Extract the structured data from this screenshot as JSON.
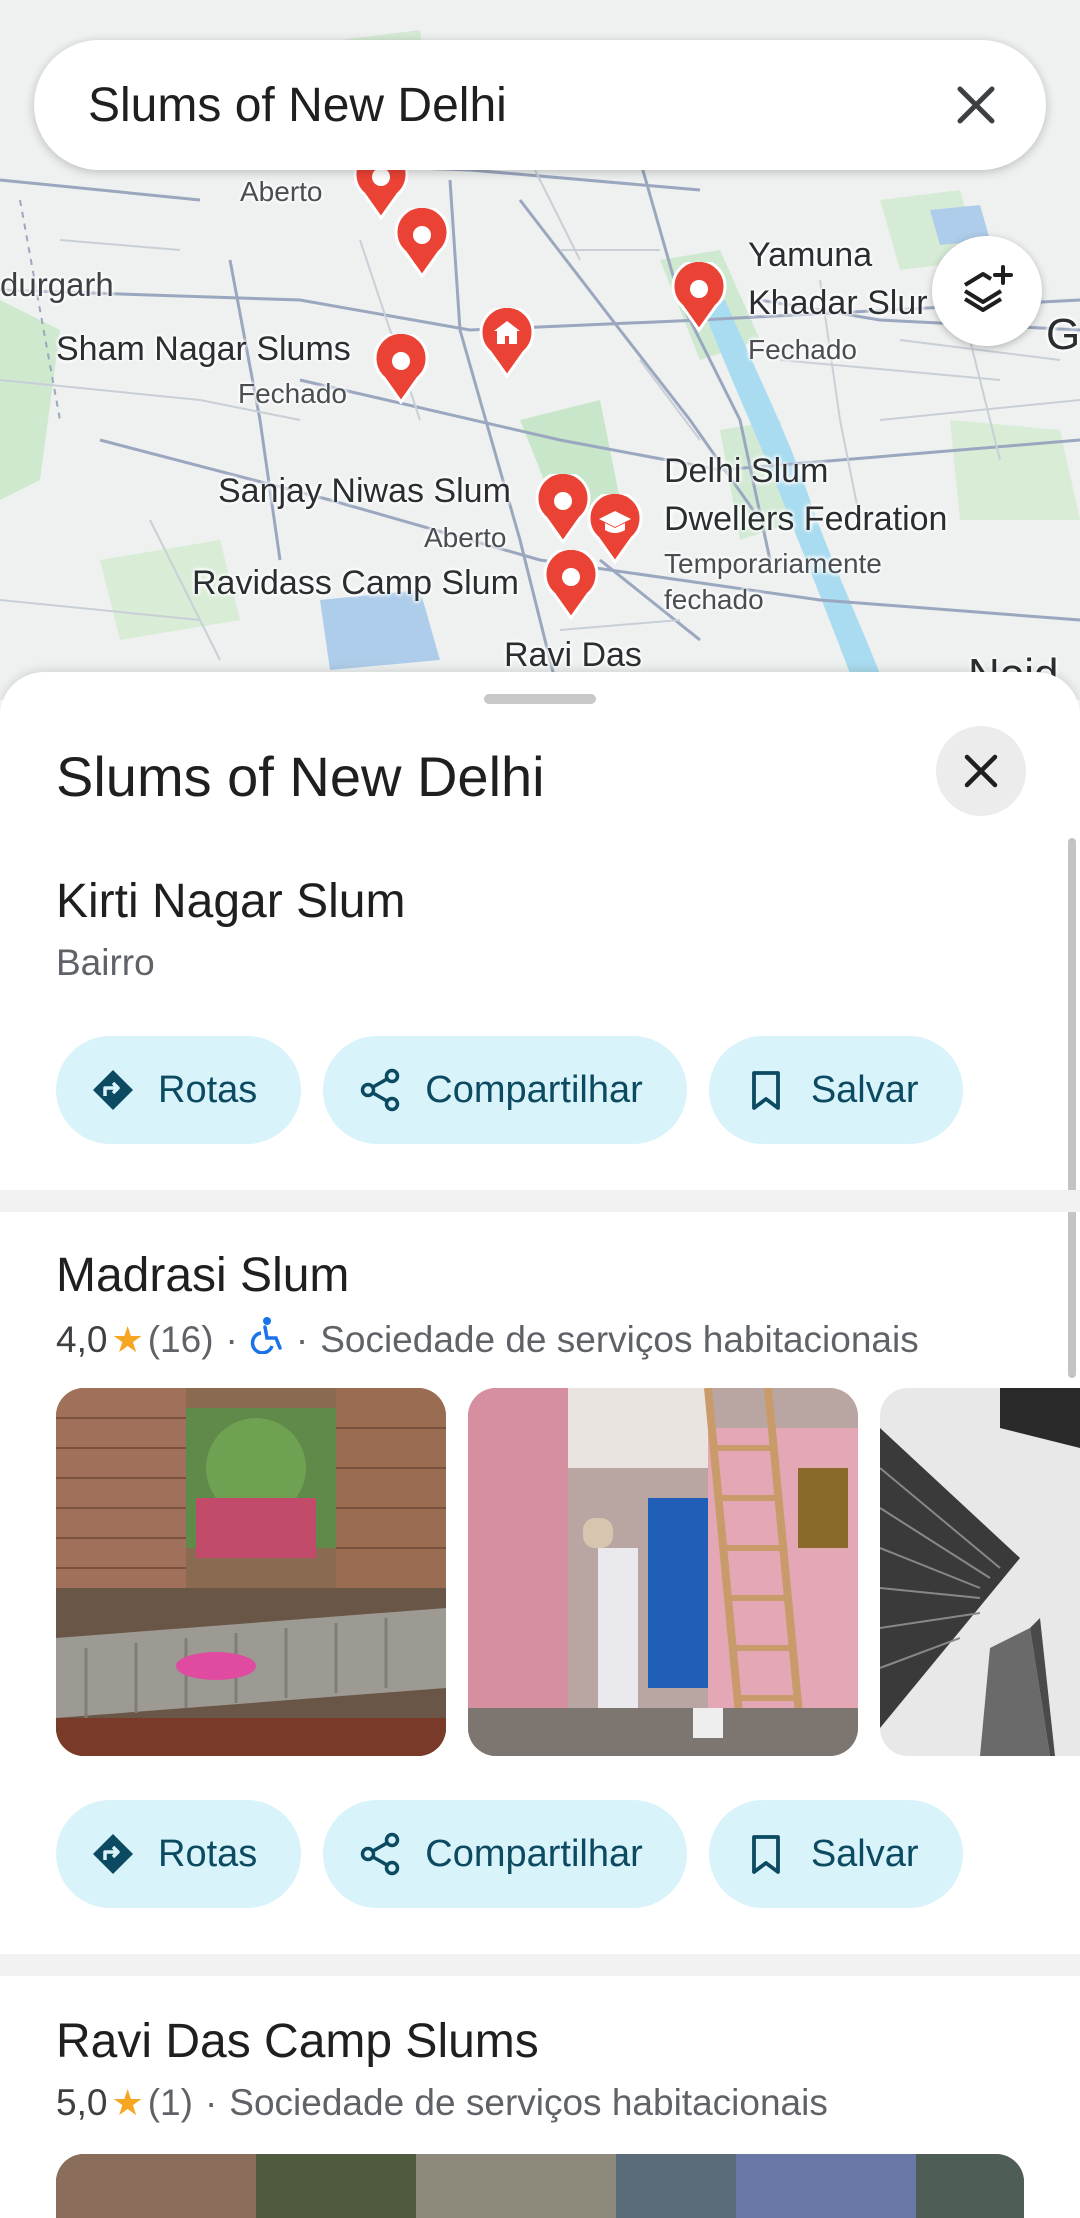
{
  "search": {
    "query": "Slums of New Delhi"
  },
  "map": {
    "labels": [
      {
        "text": "Aberto"
      },
      {
        "text": "durgarh"
      },
      {
        "text": "Sham Nagar Slums"
      },
      {
        "text": "Fechado"
      },
      {
        "text": "Yamuna"
      },
      {
        "text": "Khadar Slur"
      },
      {
        "text": "Fechado"
      },
      {
        "text": "Sanjay Niwas Slum"
      },
      {
        "text": "Aberto"
      },
      {
        "text": "Delhi Slum"
      },
      {
        "text": "Dwellers Fedration"
      },
      {
        "text": "Temporariamente"
      },
      {
        "text": "fechado"
      },
      {
        "text": "Ravidass Camp Slum"
      },
      {
        "text": "Ravi Das"
      },
      {
        "text": "Noid"
      },
      {
        "text": "G"
      }
    ]
  },
  "sheet": {
    "title": "Slums of New Delhi",
    "results": [
      {
        "name": "Kirti Nagar Slum",
        "category": "Bairro",
        "actions": {
          "directions": "Rotas",
          "share": "Compartilhar",
          "save": "Salvar"
        }
      },
      {
        "name": "Madrasi Slum",
        "rating": "4,0",
        "reviews": "(16)",
        "separator": "·",
        "category": "Sociedade de serviços habitacionais",
        "actions": {
          "directions": "Rotas",
          "share": "Compartilhar",
          "save": "Salvar"
        }
      },
      {
        "name": "Ravi Das Camp Slums",
        "rating": "5,0",
        "reviews": "(1)",
        "separator": "·",
        "category": "Sociedade de serviços habitacionais"
      }
    ]
  },
  "colors": {
    "accent": "#d9f3fb",
    "accent_text": "#0b4a61",
    "pin": "#ea4335",
    "star": "#f5a623",
    "wheelchair": "#1a73e8"
  }
}
